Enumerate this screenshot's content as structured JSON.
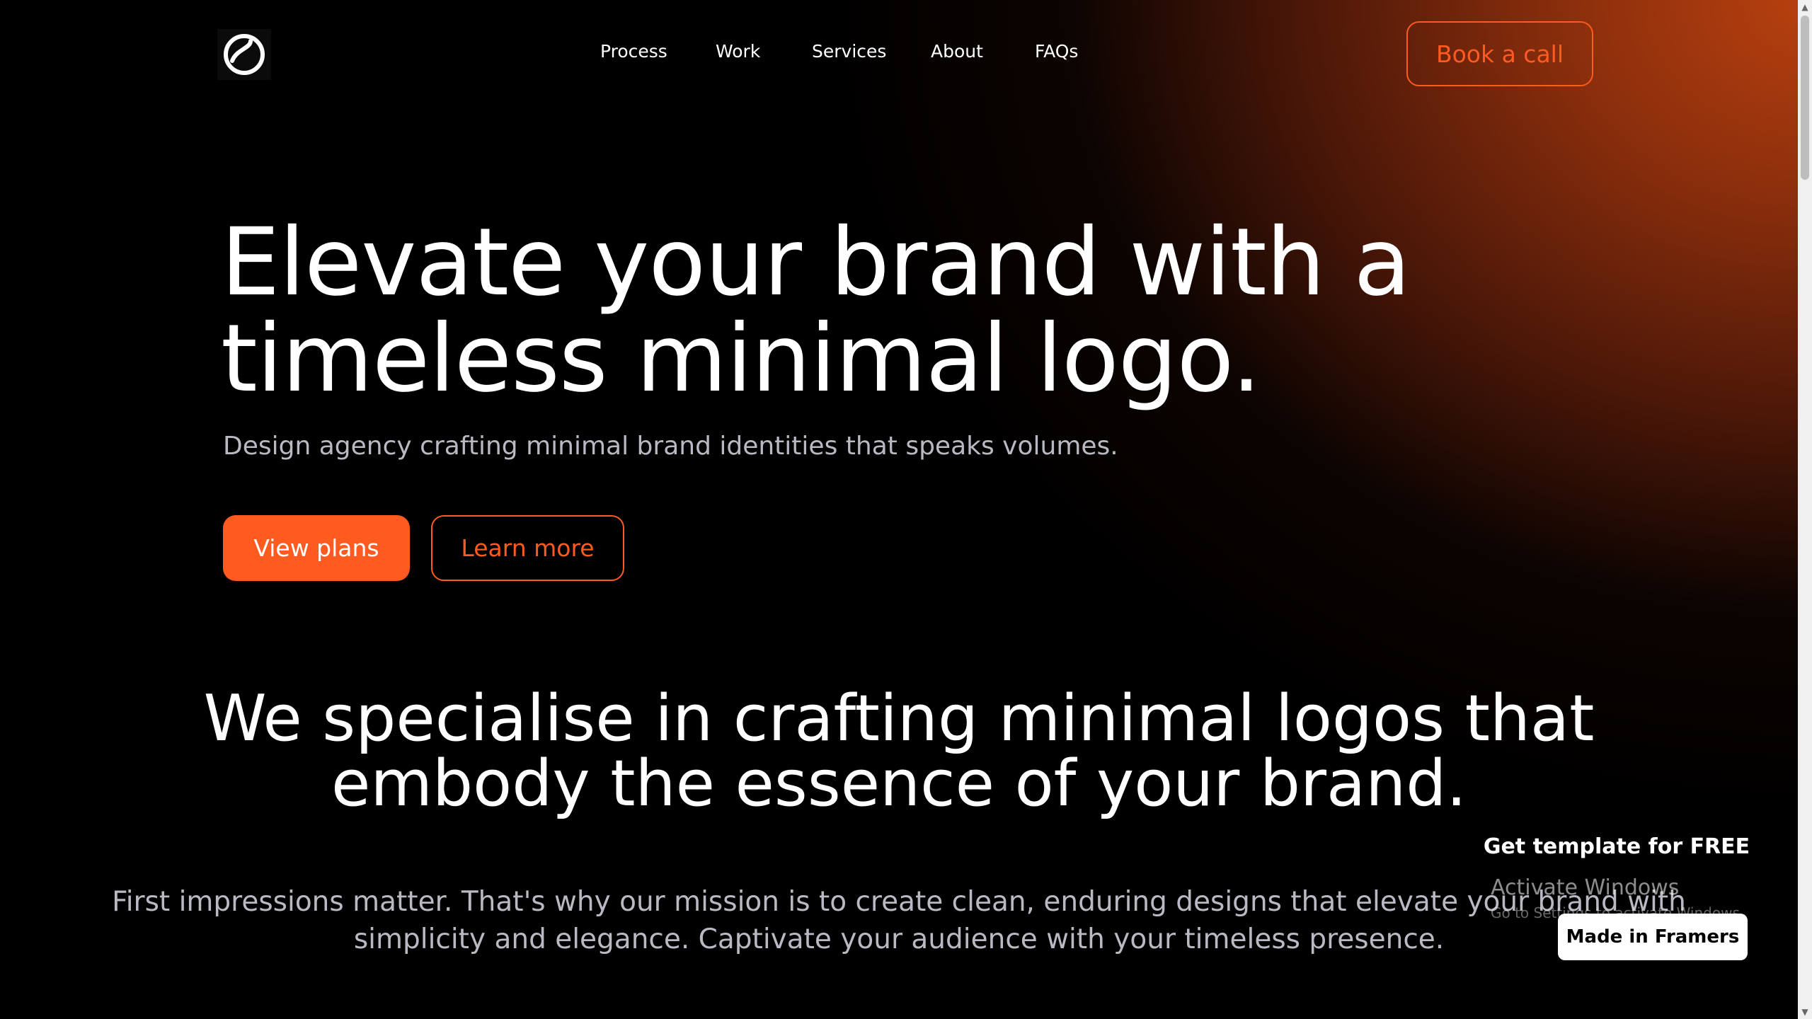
{
  "header": {
    "logo_icon": "circle-logo-icon",
    "nav": [
      "Process",
      "Work",
      "Services",
      "About",
      "FAQs"
    ],
    "cta": "Book a call"
  },
  "hero": {
    "title_line1": "Elevate your brand with a",
    "title_line2": "timeless minimal logo.",
    "subtitle": "Design agency crafting minimal brand identities that speaks volumes.",
    "primary_button": "View plans",
    "secondary_button": "Learn more"
  },
  "specialise": {
    "title_line1": "We specialise in crafting minimal logos that",
    "title_line2": "embody the essence of your brand.",
    "body_line1": "First impressions matter. That's why our mission is to create clean, enduring designs that elevate your brand with",
    "body_line2": "simplicity and elegance. Captivate your audience with your timeless presence."
  },
  "badges": {
    "get_template": "Get template for FREE",
    "made_in": "Made in Framers"
  },
  "os_overlay": {
    "activate": "Activate Windows",
    "activate_sub": "Go to Settings to activate Windows."
  },
  "colors": {
    "accent": "#ff5a1f",
    "background": "#000000",
    "muted_text": "#b9b9c4"
  }
}
